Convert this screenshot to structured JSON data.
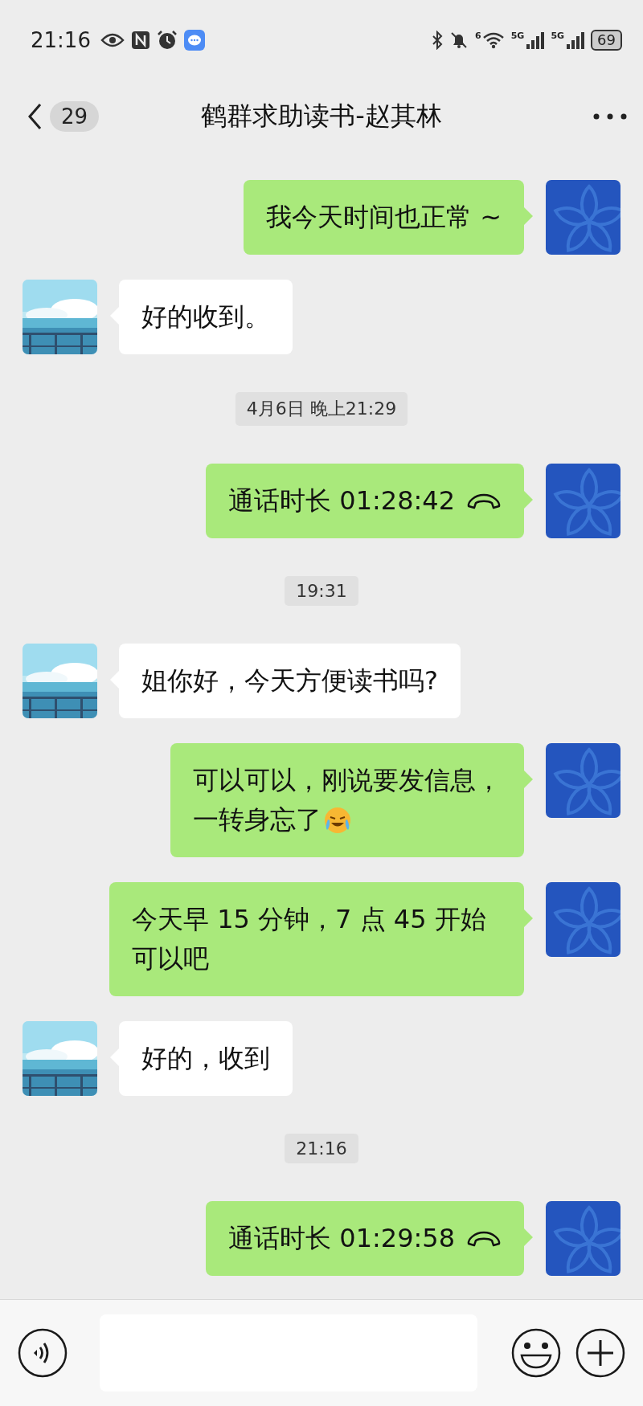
{
  "status_bar": {
    "time": "21:16",
    "wifi_label": "6",
    "signals": [
      {
        "label": "5G"
      },
      {
        "label": "5G"
      }
    ],
    "battery": "69"
  },
  "header": {
    "unread": "29",
    "title": "鹤群求助读书-赵其林"
  },
  "messages": [
    {
      "kind": "text",
      "outgoing": true,
      "text": "我今天时间也正常 ~"
    },
    {
      "kind": "text",
      "outgoing": false,
      "text": "好的收到。"
    },
    {
      "kind": "time",
      "text": "4月6日 晚上21:29"
    },
    {
      "kind": "call",
      "outgoing": true,
      "text": "通话时长 01:28:42"
    },
    {
      "kind": "time",
      "text": "19:31"
    },
    {
      "kind": "text",
      "outgoing": false,
      "text": "姐你好，今天方便读书吗?"
    },
    {
      "kind": "lines",
      "outgoing": true,
      "lines": [
        "可以可以，刚说要发信息，",
        "一转身忘了"
      ],
      "emoji": true
    },
    {
      "kind": "text",
      "outgoing": true,
      "text": "今天早 15 分钟，7 点 45 开始可以吧"
    },
    {
      "kind": "text",
      "outgoing": false,
      "text": "好的，收到"
    },
    {
      "kind": "time",
      "text": "21:16"
    },
    {
      "kind": "call",
      "outgoing": true,
      "text": "通话时长 01:29:58"
    }
  ]
}
